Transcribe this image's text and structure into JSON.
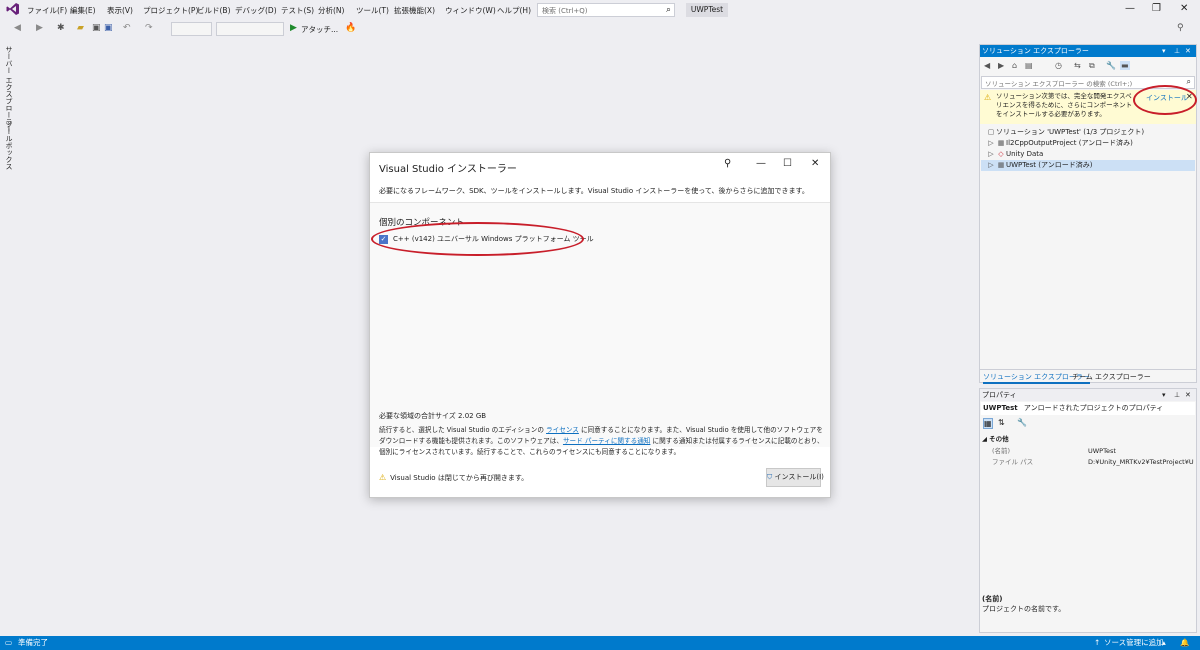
{
  "menu": {
    "items": [
      "ファイル(F)",
      "編集(E)",
      "表示(V)",
      "プロジェクト(P)",
      "ビルド(B)",
      "デバッグ(D)",
      "テスト(S)",
      "分析(N)",
      "ツール(T)",
      "拡張機能(X)",
      "ウィンドウ(W)",
      "ヘルプ(H)"
    ],
    "search_placeholder": "検索 (Ctrl+Q)",
    "project_name": "UWPTest"
  },
  "toolbar": {
    "attach_label": "アタッチ..."
  },
  "side_tabs": {
    "server_explorer": "サーバー エクスプローラー",
    "toolbox": "ツールボックス"
  },
  "solution_explorer": {
    "title": "ソリューション エクスプローラー",
    "search_placeholder": "ソリューション エクスプローラー の検索 (Ctrl+;)",
    "info_message": "ソリューション次第では、完全な開発エクスペリエンスを得るために、さらにコンポーネントをインストールする必要があります。",
    "install_link": "インストール",
    "items": [
      "ソリューション 'UWPTest' (1/3 プロジェクト)",
      "Il2CppOutputProject (アンロード済み)",
      "Unity Data",
      "UWPTest (アンロード済み)"
    ],
    "tabs": [
      "ソリューション エクスプローラー",
      "チーム エクスプローラー"
    ]
  },
  "properties": {
    "title": "プロパティ",
    "selected_object": "UWPTest",
    "selected_type": "アンロードされたプロジェクトのプロパティ",
    "category": "その他",
    "rows": [
      {
        "name": "(名前)",
        "value": "UWPTest"
      },
      {
        "name": "ファイル パス",
        "value": "D:¥Unity_MRTKv2¥TestProject¥U"
      }
    ],
    "desc_title": "(名前)",
    "desc_text": "プロジェクトの名前です。"
  },
  "status": {
    "ready": "準備完了",
    "source_control": "ソース管理に追加"
  },
  "installer": {
    "title": "Visual Studio インストーラー",
    "subtitle": "必要になるフレームワーク、SDK、ツールをインストールします。Visual Studio インストーラーを使って、後からさらに追加できます。",
    "section_title": "個別のコンポーネント",
    "component_label": "C++ (v142) ユニバーサル Windows プラットフォーム ツール",
    "size_text": "必要な領域の合計サイズ 2.02 GB",
    "license_part1": "続行すると、選択した Visual Studio のエディションの",
    "license_link1": "ライセンス",
    "license_part2": "に同意することになります。また、Visual Studio を使用して他のソフトウェアをダウンロードする機能も提供されます。このソフトウェアは、",
    "license_link2": "サード パーティに関する通知",
    "license_part3": "に関する通知または付属するライセンスに記載のとおり、個別にライセンスされています。続行することで、これらのライセンスにも同意することになります。",
    "warning_text": "Visual Studio は閉じてから再び開きます。",
    "install_button": "インストール(I)"
  },
  "colors": {
    "accent": "#007acc",
    "annotation": "#c81e2a",
    "infobar": "#fffbd3"
  }
}
